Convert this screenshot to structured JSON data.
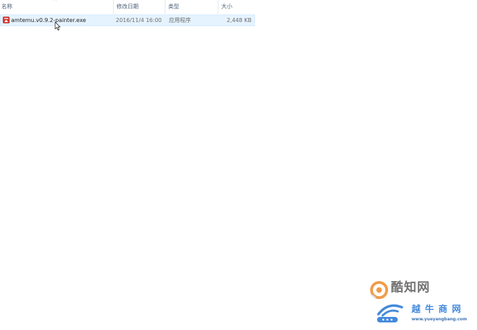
{
  "columns": {
    "name": "名称",
    "date_modified": "修改日期",
    "type": "类型",
    "size": "大小",
    "sort_indicator": "^"
  },
  "files": [
    {
      "name": "amtemu.v0.9.2-painter.exe",
      "date_modified": "2016/11/4 16:00",
      "type": "应用程序",
      "size": "2,448 KB",
      "icon": "exe-app-icon"
    }
  ],
  "watermark": {
    "brand_1": "酷知网",
    "brand_2": "越 牛 商 网",
    "url": "www.yueyangbang.com"
  },
  "colors": {
    "header_text": "#4c607a",
    "selection_bg": "#e5f3ff",
    "icon_red": "#d9322a",
    "watermark_blue": "#2376d6",
    "watermark_orange": "#f08a2a"
  }
}
